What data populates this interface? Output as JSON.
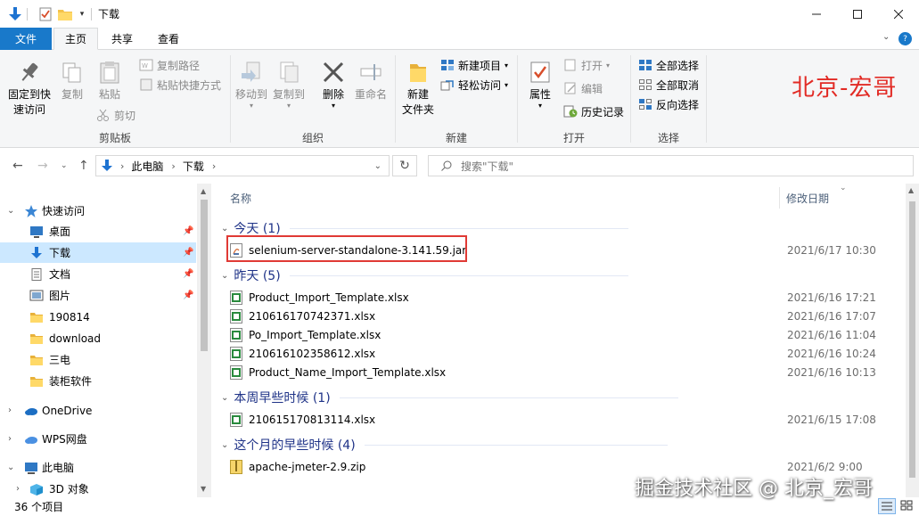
{
  "window": {
    "title": "下载",
    "quick_access_dropdown": "▾"
  },
  "tabs": {
    "file": "文件",
    "home": "主页",
    "share": "共享",
    "view": "查看"
  },
  "ribbon": {
    "clipboard": {
      "group": "剪贴板",
      "pin_line1": "固定到快",
      "pin_line2": "速访问",
      "copy": "复制",
      "paste": "粘贴",
      "copy_path": "复制路径",
      "paste_shortcut": "粘贴快捷方式",
      "cut": "剪切"
    },
    "organize": {
      "group": "组织",
      "move_to": "移动到",
      "copy_to": "复制到",
      "delete": "删除",
      "rename": "重命名"
    },
    "new": {
      "group": "新建",
      "new_folder_line1": "新建",
      "new_folder_line2": "文件夹",
      "new_item": "新建项目",
      "easy_access": "轻松访问"
    },
    "open": {
      "group": "打开",
      "properties": "属性",
      "open": "打开",
      "edit": "编辑",
      "history": "历史记录"
    },
    "select": {
      "group": "选择",
      "select_all": "全部选择",
      "select_none": "全部取消",
      "invert": "反向选择"
    },
    "brand_text": "北京-宏哥"
  },
  "address": {
    "crumbs": [
      "此电脑",
      "下载"
    ],
    "search_placeholder": "搜索\"下载\""
  },
  "nav": {
    "quick_access": "快速访问",
    "desktop": "桌面",
    "downloads": "下载",
    "documents": "文档",
    "pictures": "图片",
    "folder_190814": "190814",
    "folder_download": "download",
    "folder_sandian": "三电",
    "folder_software": "装柜软件",
    "onedrive": "OneDrive",
    "wps": "WPS网盘",
    "this_pc": "此电脑",
    "objects_3d": "3D 对象"
  },
  "columns": {
    "name": "名称",
    "modified": "修改日期"
  },
  "groups": [
    {
      "label": "今天 (1)",
      "files": [
        {
          "name": "selenium-server-standalone-3.141.59.jar",
          "date": "2021/6/17 10:30",
          "type": "jar"
        }
      ]
    },
    {
      "label": "昨天 (5)",
      "files": [
        {
          "name": "Product_Import_Template.xlsx",
          "date": "2021/6/16 17:21",
          "type": "xlsx"
        },
        {
          "name": "210616170742371.xlsx",
          "date": "2021/6/16 17:07",
          "type": "xlsx"
        },
        {
          "name": "Po_Import_Template.xlsx",
          "date": "2021/6/16 11:04",
          "type": "xlsx"
        },
        {
          "name": "210616102358612.xlsx",
          "date": "2021/6/16 10:24",
          "type": "xlsx"
        },
        {
          "name": "Product_Name_Import_Template.xlsx",
          "date": "2021/6/16 10:13",
          "type": "xlsx"
        }
      ]
    },
    {
      "label": "本周早些时候 (1)",
      "files": [
        {
          "name": "210615170813114.xlsx",
          "date": "2021/6/15 17:08",
          "type": "xlsx"
        }
      ]
    },
    {
      "label": "这个月的早些时候 (4)",
      "files": [
        {
          "name": "apache-jmeter-2.9.zip",
          "date": "2021/6/2 9:00",
          "type": "zip"
        }
      ]
    }
  ],
  "status": {
    "item_count": "36 个项目"
  },
  "watermark": "掘金技术社区 @ 北京_宏哥"
}
